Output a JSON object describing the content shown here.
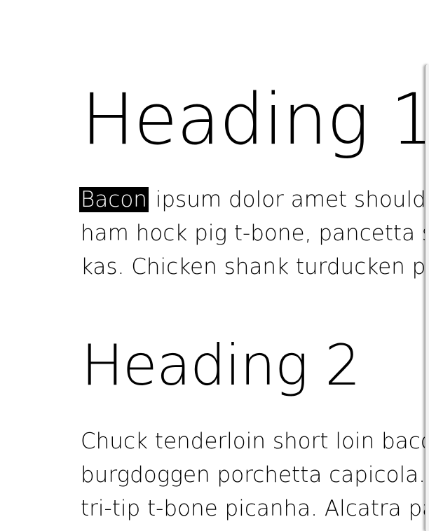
{
  "document": {
    "heading1": "Heading 1",
    "paragraph1": {
      "selected_word": "Bacon",
      "line1_rest": " ipsum dolor amet shoulder b",
      "line2": "ham hock pig t-bone, pancetta spar",
      "line3": "kas. Chicken shank turducken pork"
    },
    "heading2": "Heading 2",
    "paragraph2": {
      "line1": "Chuck tenderloin short loin bacon,",
      "line2": "burgdoggen porchetta capicola. To",
      "line3": "tri-tip t-bone picanha. Alcatra panc"
    }
  },
  "colors": {
    "background": "#ffffff",
    "text": "#000000",
    "selection_bg": "#000000",
    "selection_text": "#ffffff"
  }
}
